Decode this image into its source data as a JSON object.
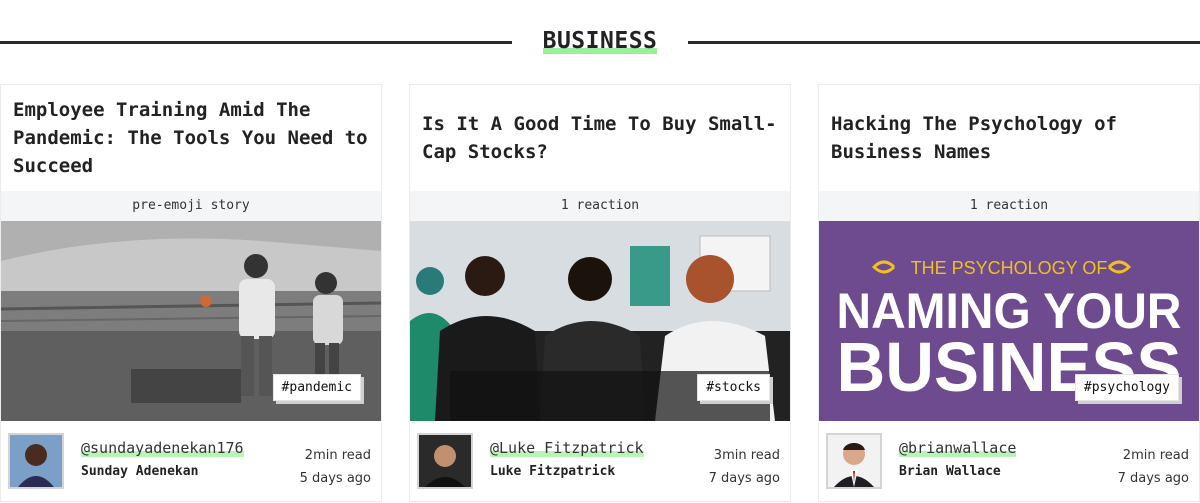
{
  "section": {
    "title": "BUSINESS"
  },
  "cards": [
    {
      "title": "Employee Training Amid The Pandemic: The Tools You Need to Succeed",
      "reactions": "pre-emoji story",
      "tag": "#pandemic",
      "author": {
        "handle": "@sundayadenekan176",
        "name": "Sunday Adenekan"
      },
      "read_time": "2min read",
      "posted": "5 days ago"
    },
    {
      "title": "Is It A Good Time To Buy Small-Cap Stocks?",
      "reactions": "1 reaction",
      "tag": "#stocks",
      "author": {
        "handle": "@Luke Fitzpatrick",
        "name": "Luke Fitzpatrick"
      },
      "read_time": "3min read",
      "posted": "7 days ago"
    },
    {
      "title": "Hacking The Psychology of Business Names",
      "reactions": "1 reaction",
      "tag": "#psychology",
      "image_text": {
        "line1": "THE PSYCHOLOGY OF",
        "line2": "NAMING YOUR",
        "line3": "BUSINESS"
      },
      "author": {
        "handle": "@brianwallace",
        "name": "Brian Wallace"
      },
      "read_time": "2min read",
      "posted": "7 days ago"
    }
  ],
  "colors": {
    "highlight": "#9af09a",
    "rule": "#2b2b2b",
    "purple": "#6e4a8e"
  }
}
